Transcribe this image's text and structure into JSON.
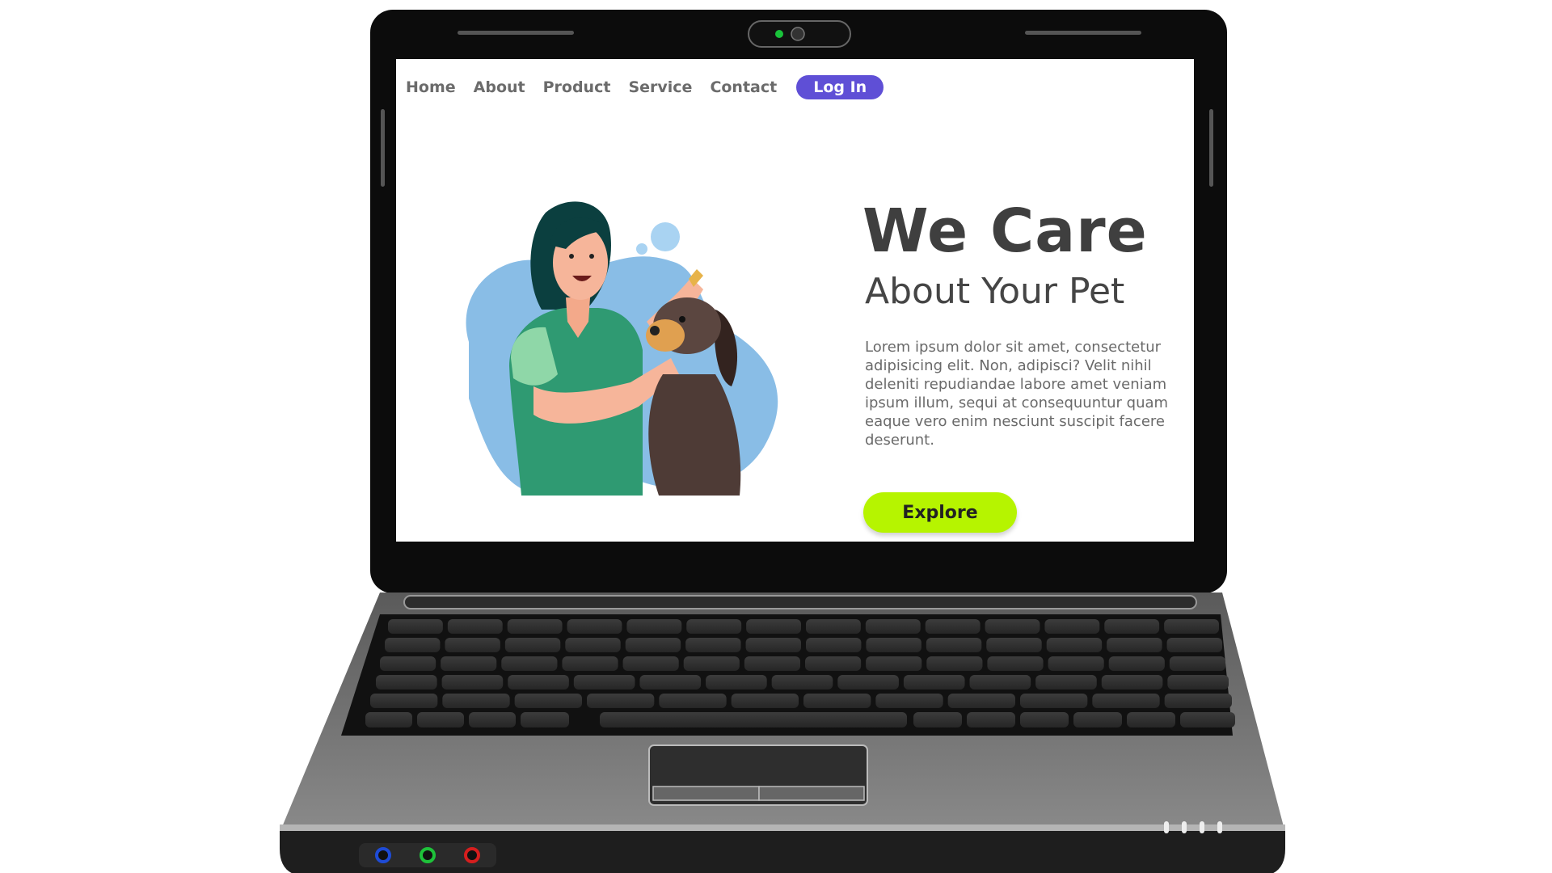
{
  "nav": {
    "items": [
      {
        "label": "Home"
      },
      {
        "label": "About"
      },
      {
        "label": "Product"
      },
      {
        "label": "Service"
      },
      {
        "label": "Contact"
      }
    ],
    "login_label": "Log In"
  },
  "hero": {
    "title": "We Care",
    "subtitle": "About Your Pet",
    "body": "Lorem ipsum dolor sit amet, consectetur adipisicing elit. Non, adipisci? Velit nihil deleniti repudiandae labore amet veniam ipsum illum, sequi at consequuntur quam eaque vero enim nesciunt suscipit facere deserunt.",
    "cta_label": "Explore"
  },
  "colors": {
    "accent": "#5f4fd6",
    "cta": "#b6f400",
    "laptop": "#1a1a1a"
  },
  "illustration": {
    "icon": "woman-with-dog-illustration"
  }
}
